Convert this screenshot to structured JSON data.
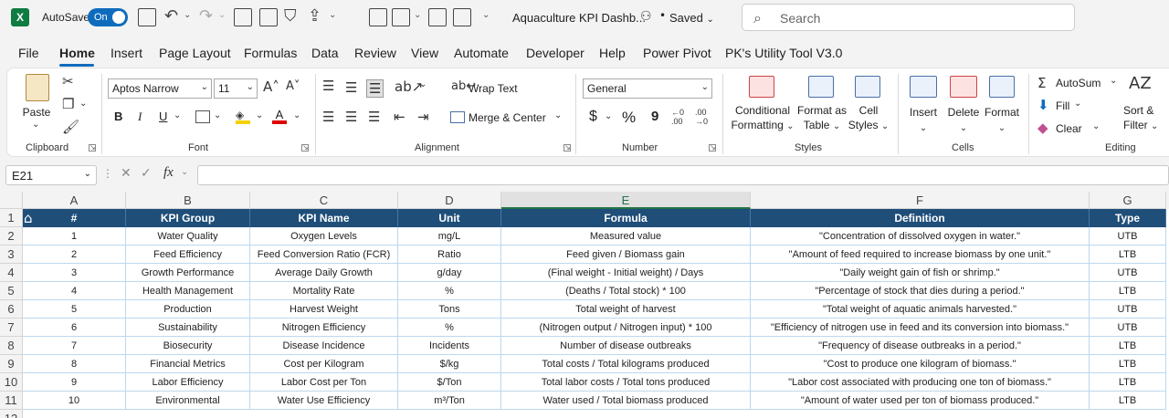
{
  "titlebar": {
    "autosave_label": "AutoSave",
    "autosave_state": "On",
    "doc_title": "Aquaculture KPI Dashb...",
    "saved_status": "Saved",
    "search_placeholder": "Search"
  },
  "menu": {
    "tabs": [
      "File",
      "Home",
      "Insert",
      "Page Layout",
      "Formulas",
      "Data",
      "Review",
      "View",
      "Automate",
      "Developer",
      "Help",
      "Power Pivot",
      "PK's Utility Tool V3.0"
    ],
    "active": "Home"
  },
  "ribbon": {
    "clipboard": {
      "paste": "Paste",
      "label": "Clipboard"
    },
    "font": {
      "name": "Aptos Narrow",
      "size": "11",
      "bold": "B",
      "italic": "I",
      "underline": "U",
      "label": "Font"
    },
    "alignment": {
      "wrap_text": "Wrap Text",
      "merge_center": "Merge & Center",
      "label": "Alignment"
    },
    "number": {
      "format": "General",
      "currency": "$",
      "percent": "%",
      "comma": "9",
      "inc_decimal": ".00",
      "dec_decimal": ".00",
      "label": "Number"
    },
    "styles": {
      "conditional_formatting": "Conditional",
      "conditional_formatting_2": "Formatting",
      "format_as_table": "Format as",
      "format_as_table_2": "Table",
      "cell_styles": "Cell",
      "cell_styles_2": "Styles",
      "label": "Styles"
    },
    "cells": {
      "insert": "Insert",
      "delete": "Delete",
      "format": "Format",
      "label": "Cells"
    },
    "editing": {
      "autosum": "AutoSum",
      "fill": "Fill",
      "clear": "Clear",
      "sort_filter": "Sort &",
      "sort_filter_2": "Filter",
      "label": "Editing"
    }
  },
  "formula_bar": {
    "name_box": "E21",
    "fx": "fx",
    "value": ""
  },
  "columns": [
    "A",
    "B",
    "C",
    "D",
    "E",
    "F",
    "G"
  ],
  "selected_column": "E",
  "row_numbers": [
    "1",
    "2",
    "3",
    "4",
    "5",
    "6",
    "7",
    "8",
    "9",
    "10",
    "11",
    "12"
  ],
  "table": {
    "headers": [
      "#",
      "KPI Group",
      "KPI Name",
      "Unit",
      "Formula",
      "Definition",
      "Type"
    ],
    "rows": [
      [
        "1",
        "Water Quality",
        "Oxygen Levels",
        "mg/L",
        "Measured value",
        "\"Concentration of dissolved oxygen in water.\"",
        "UTB"
      ],
      [
        "2",
        "Feed Efficiency",
        "Feed Conversion Ratio (FCR)",
        "Ratio",
        "Feed given / Biomass gain",
        "\"Amount of feed required to increase biomass by one unit.\"",
        "LTB"
      ],
      [
        "3",
        "Growth Performance",
        "Average Daily Growth",
        "g/day",
        "(Final weight - Initial weight) / Days",
        "\"Daily weight gain of fish or shrimp.\"",
        "UTB"
      ],
      [
        "4",
        "Health Management",
        "Mortality Rate",
        "%",
        "(Deaths / Total stock) * 100",
        "\"Percentage of stock that dies during a period.\"",
        "LTB"
      ],
      [
        "5",
        "Production",
        "Harvest Weight",
        "Tons",
        "Total weight of harvest",
        "\"Total weight of aquatic animals harvested.\"",
        "UTB"
      ],
      [
        "6",
        "Sustainability",
        "Nitrogen Efficiency",
        "%",
        "(Nitrogen output / Nitrogen input) * 100",
        "\"Efficiency of nitrogen use in feed and its conversion into biomass.\"",
        "UTB"
      ],
      [
        "7",
        "Biosecurity",
        "Disease Incidence",
        "Incidents",
        "Number of disease outbreaks",
        "\"Frequency of disease outbreaks in a period.\"",
        "LTB"
      ],
      [
        "8",
        "Financial Metrics",
        "Cost per Kilogram",
        "$/kg",
        "Total costs / Total kilograms produced",
        "\"Cost to produce one kilogram of biomass.\"",
        "LTB"
      ],
      [
        "9",
        "Labor Efficiency",
        "Labor Cost per Ton",
        "$/Ton",
        "Total labor costs / Total tons produced",
        "\"Labor cost associated with producing one ton of biomass.\"",
        "LTB"
      ],
      [
        "10",
        "Environmental",
        "Water Use Efficiency",
        "m³/Ton",
        "Water used / Total biomass produced",
        "\"Amount of water used per ton of biomass produced.\"",
        "LTB"
      ]
    ]
  },
  "colors": {
    "header_fill": "#1f4e79",
    "header_text": "#ffffff",
    "cell_border": "#bdd7ee",
    "accent": "#0f6cbd"
  }
}
